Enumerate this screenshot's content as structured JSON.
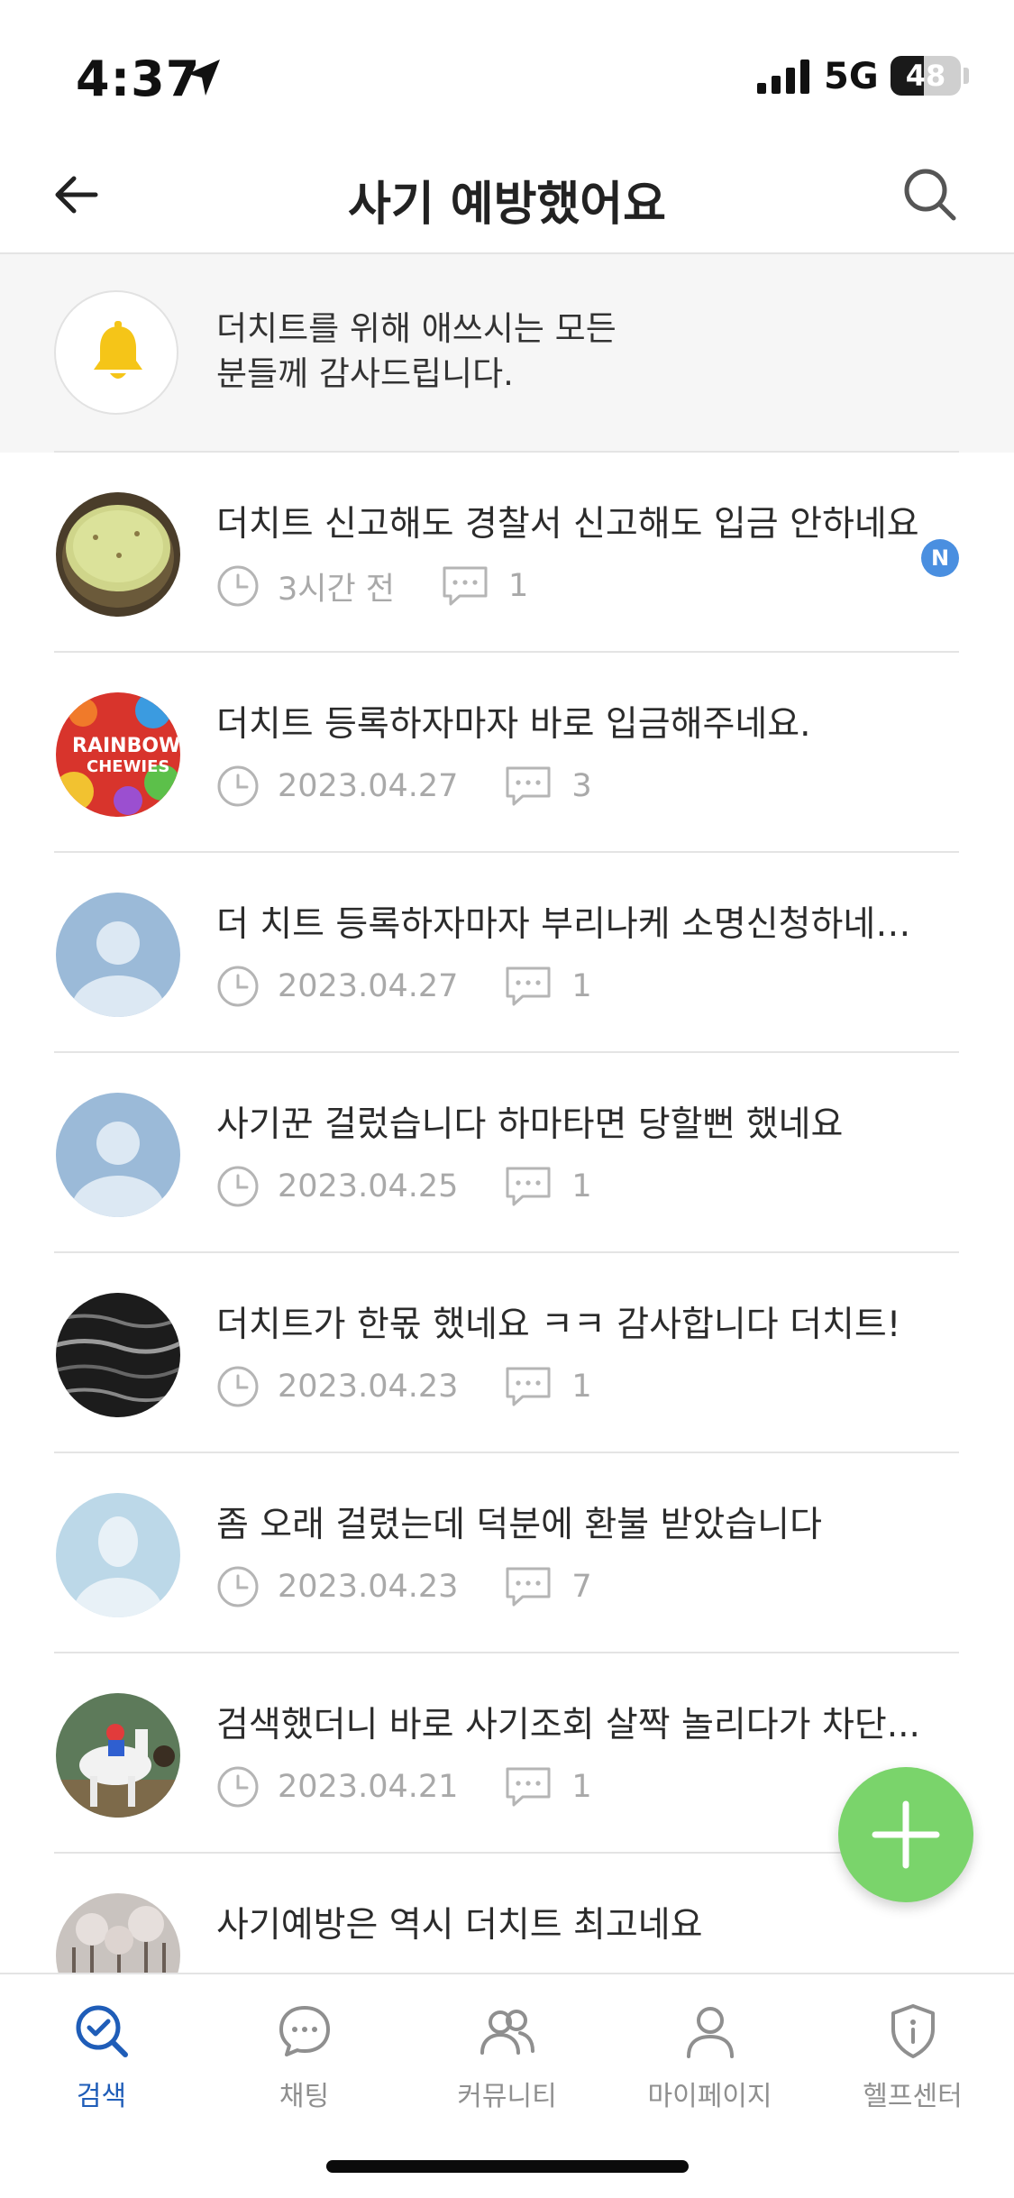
{
  "status_bar": {
    "time": "4:37",
    "network": "5G",
    "battery": "48",
    "battery_level": 0.48
  },
  "header": {
    "title": "사기 예방했어요",
    "back_icon": "arrow-left-icon",
    "search_icon": "search-icon"
  },
  "notice": {
    "text": "더치트를 위해 애쓰시는 모든\n분들께 감사드립니다.",
    "icon": "bell-icon",
    "icon_color": "#f5c518"
  },
  "posts": [
    {
      "title": "더치트 신고해도 경찰서 신고해도 입금 안하네요",
      "date": "3시간 전",
      "comments": "1",
      "is_new": true,
      "new_badge": "N"
    },
    {
      "title": "더치트 등록하자마자 바로 입금해주네요.",
      "date": "2023.04.27",
      "comments": "3",
      "is_new": false
    },
    {
      "title": "더 치트 등록하자마자 부리나케 소명신청하네요...",
      "date": "2023.04.27",
      "comments": "1",
      "is_new": false
    },
    {
      "title": "사기꾼 걸렀습니다 하마타면 당할뻔 했네요",
      "date": "2023.04.25",
      "comments": "1",
      "is_new": false
    },
    {
      "title": "더치트가 한몫 했네요 ㅋㅋ 감사합니다 더치트!",
      "date": "2023.04.23",
      "comments": "1",
      "is_new": false
    },
    {
      "title": "좀 오래 걸렸는데 덕분에 환불 받았습니다",
      "date": "2023.04.23",
      "comments": "7",
      "is_new": false
    },
    {
      "title": "검색했더니 바로 사기조회 살짝 놀리다가 차단...",
      "date": "2023.04.21",
      "comments": "1",
      "is_new": false
    },
    {
      "title": "사기예방은 역시 더치트 최고네요",
      "date": "",
      "comments": "",
      "is_new": false
    }
  ],
  "fab": {
    "icon": "plus-icon",
    "color": "#7ad46b"
  },
  "tabs": [
    {
      "label": "검색",
      "icon": "search-check-icon",
      "active": true
    },
    {
      "label": "채팅",
      "icon": "chat-bubble-icon",
      "active": false
    },
    {
      "label": "커뮤니티",
      "icon": "users-icon",
      "active": false
    },
    {
      "label": "마이페이지",
      "icon": "user-icon",
      "active": false
    },
    {
      "label": "헬프센터",
      "icon": "shield-info-icon",
      "active": false
    }
  ],
  "colors": {
    "accent": "#1f5db8",
    "muted": "#a9a9a9",
    "divider": "#e4e4e4"
  }
}
